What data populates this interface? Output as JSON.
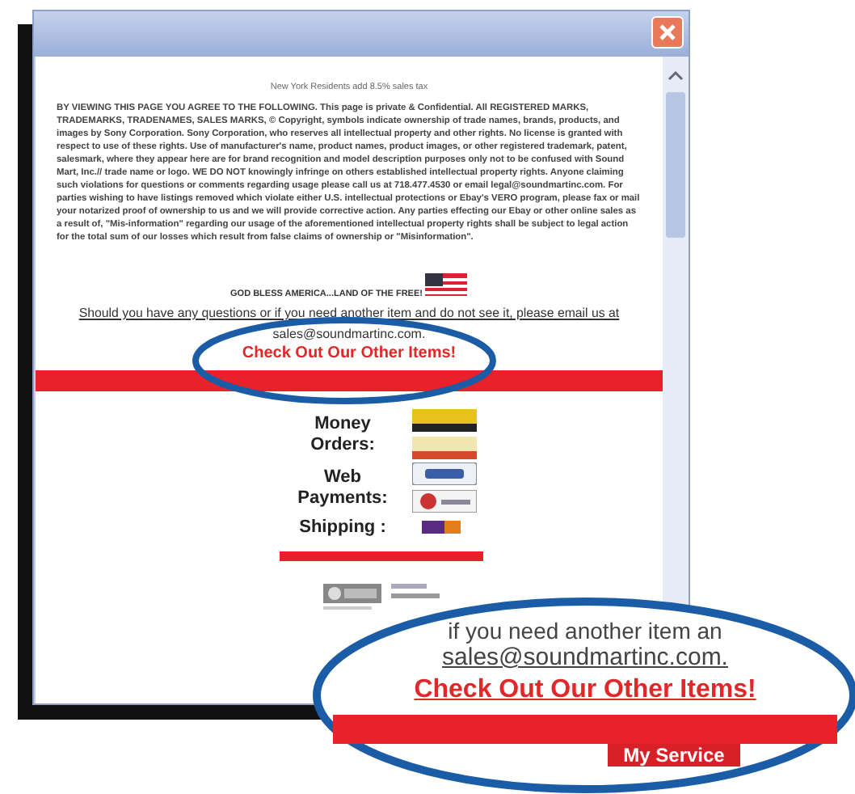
{
  "page": {
    "tax_note": "New York Residents add 8.5% sales tax",
    "legal_notice": "BY VIEWING THIS PAGE YOU AGREE TO THE FOLLOWING. This page is private & Confidential. All REGISTERED MARKS, TRADEMARKS, TRADENAMES, SALES MARKS, © Copyright, symbols indicate ownership of trade names, brands, products, and images by Sony Corporation. Sony Corporation, who reserves all intellectual property and other rights. No license is granted with respect to use of these rights. Use of manufacturer's name, product names, product images, or other registered trademark, patent, salesmark, where they appear here are for brand recognition and model description purposes only not to be confused with Sound Mart, Inc.// trade name or logo. WE DO NOT knowingly infringe on others established intellectual property rights. Anyone claiming such violations for questions or comments regarding usage please call us at 718.477.4530 or email legal@soundmartinc.com. For parties wishing to have listings removed which violate either U.S. intellectual protections or Ebay's VERO program, please fax or mail your notarized proof of ownership to us and we will provide corrective action. Any parties effecting our Ebay or other online sales as a result of, \"Mis-information\" regarding our usage of the aforementioned intellectual property rights shall be subject to legal action for the total sum of our losses which result from false claims of ownership or \"Misinformation\".",
    "slogan": "GOD BLESS AMERICA...LAND OF THE FREE!",
    "contact_text": "Should you have any questions or if you need another item and do not see it, please email us at",
    "email": "sales@soundmartinc.com.",
    "other_items_link": "Check Out Our Other Items!",
    "payments": [
      {
        "label": "Money Orders:",
        "logos": [
          {
            "kind": "money-order"
          },
          {
            "kind": "postal"
          }
        ]
      },
      {
        "label": "Web Payments:",
        "logos": [
          {
            "kind": "paypal"
          },
          {
            "kind": "card"
          }
        ]
      },
      {
        "label": "Shipping :",
        "logos": [
          {
            "kind": "fedex"
          }
        ]
      }
    ]
  },
  "magnifier": {
    "line": "if you need another item an",
    "email": "sales@soundmartinc.com.",
    "link": "Check Out Our Other Items!",
    "tab": "My Service"
  }
}
